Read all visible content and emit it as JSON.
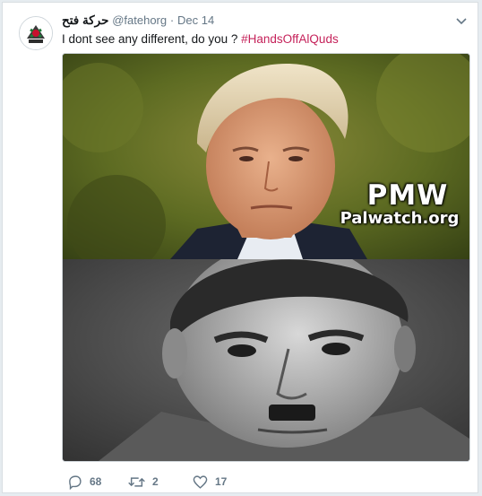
{
  "tweet": {
    "display_name": "حركة فتح",
    "handle": "@fatehorg",
    "separator": "·",
    "date": "Dec 14",
    "text_prefix": "I dont see any different, do you ? ",
    "hashtag": "#HandsOffAlQuds",
    "media": {
      "watermark_title": "PMW",
      "watermark_site": "Palwatch.org"
    },
    "actions": {
      "replies": "68",
      "retweets": "2",
      "likes": "17"
    }
  },
  "colors": {
    "text": "#14171a",
    "secondary": "#657786",
    "hashtag": "#c5225a",
    "background": "#e6ecf0"
  },
  "icons": [
    "fateh-logo-avatar",
    "chevron-down-icon",
    "reply-icon",
    "retweet-icon",
    "like-icon"
  ]
}
